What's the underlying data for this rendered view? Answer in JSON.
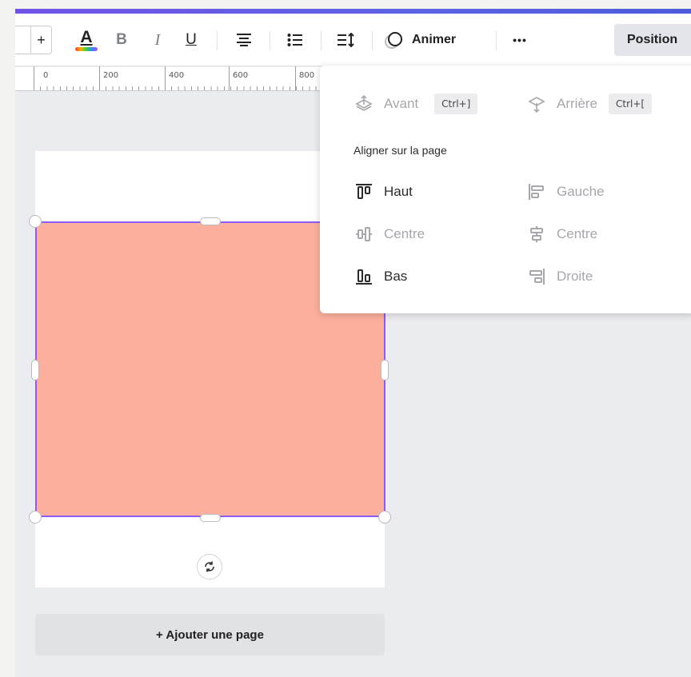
{
  "toolbar": {
    "font_size_increase": "+",
    "text_color_letter": "A",
    "bold": "B",
    "italic": "I",
    "underline": "U",
    "animate_label": "Animer",
    "more": "•••",
    "position_label": "Position"
  },
  "ruler": {
    "labels": [
      "0",
      "200",
      "400",
      "600",
      "800"
    ]
  },
  "dropdown": {
    "forward": {
      "label": "Avant",
      "shortcut": "Ctrl+]"
    },
    "backward": {
      "label": "Arrière",
      "shortcut": "Ctrl+["
    },
    "align_heading": "Aligner sur la page",
    "align": {
      "top": "Haut",
      "left": "Gauche",
      "middle": "Centre",
      "center": "Centre",
      "bottom": "Bas",
      "right": "Droite"
    }
  },
  "canvas": {
    "shape_color": "#fcaf9d",
    "selection_color": "#8b5cf6"
  },
  "add_page_label": "+ Ajouter une page",
  "colors": {
    "accent_gradient_start": "#7152e8",
    "accent_gradient_end": "#4b5bd9",
    "disabled_text": "#a5a7ad"
  }
}
